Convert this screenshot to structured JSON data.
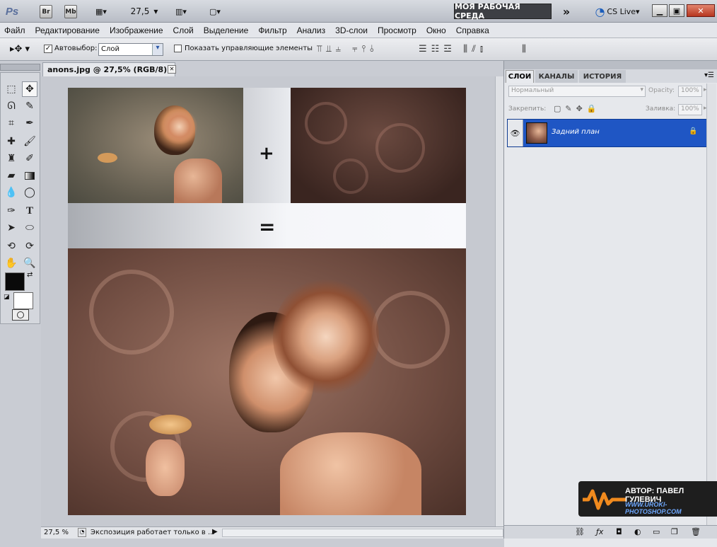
{
  "app": {
    "logo": "Ps",
    "bridge": "Br",
    "minibridge": "Mb",
    "zoom": "27,5",
    "workspace": "МОЯ РАБОЧАЯ СРЕДА",
    "more": "»",
    "cslive": "CS Live"
  },
  "menu": [
    "Файл",
    "Редактирование",
    "Изображение",
    "Слой",
    "Выделение",
    "Фильтр",
    "Анализ",
    "3D-слои",
    "Просмотр",
    "Окно",
    "Справка"
  ],
  "options": {
    "autoselect_label": "Автовыбор:",
    "autoselect_value": "Слой",
    "show_controls_label": "Показать управляющие элементы"
  },
  "document": {
    "tab_title": "anons.jpg @ 27,5% (RGB/8)",
    "close": "✕",
    "plus_sign": "+",
    "equals_sign": "="
  },
  "status": {
    "zoom": "27,5 %",
    "message": "Экспозиция работает только в ..."
  },
  "layers_panel": {
    "tabs": [
      "СЛОИ",
      "КАНАЛЫ",
      "ИСТОРИЯ"
    ],
    "blend_mode": "Нормальный",
    "opacity_label": "Opacity:",
    "opacity_value": "100%",
    "lock_label": "Закрепить:",
    "fill_label": "Заливка:",
    "fill_value": "100%",
    "layer_name": "Задний план",
    "footer_icons": [
      "link-icon",
      "fx-icon",
      "mask-icon",
      "adjustment-icon",
      "group-icon",
      "new-layer-icon",
      "trash-icon"
    ]
  },
  "watermark": {
    "author": "АВТОР: ПАВЕЛ ГУЛЕВИЧ",
    "site": "WWW.UROKI-PHOTOSHOP.COM"
  },
  "colors": {
    "accent": "#1f56c4",
    "background_swatch": "#0a0a0a"
  }
}
